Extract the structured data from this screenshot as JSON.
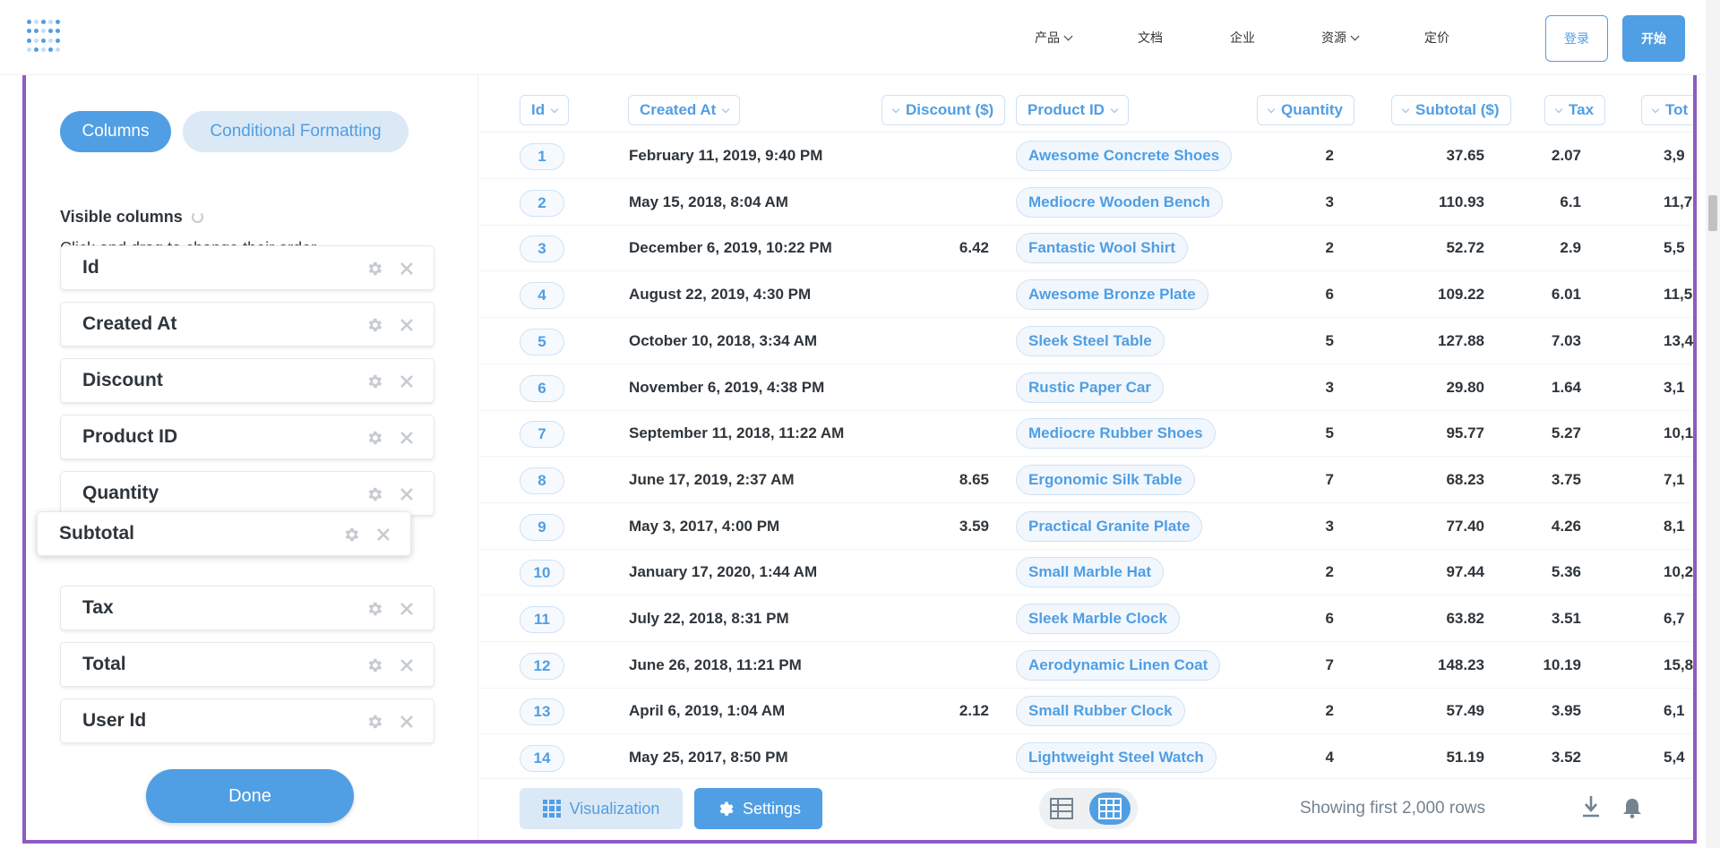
{
  "nav": {
    "links": [
      {
        "label": "产品",
        "has_caret": true
      },
      {
        "label": "文档",
        "has_caret": false
      },
      {
        "label": "企业",
        "has_caret": false
      },
      {
        "label": "资源",
        "has_caret": true
      },
      {
        "label": "定价",
        "has_caret": false
      }
    ],
    "login_label": "登录",
    "start_label": "开始"
  },
  "sidebar": {
    "tab_columns": "Columns",
    "tab_conditional": "Conditional Formatting",
    "visible_title": "Visible columns",
    "visible_subtitle": "Click and drag to change their order",
    "columns": [
      "Id",
      "Created At",
      "Discount",
      "Product ID",
      "Quantity",
      "Subtotal",
      "Tax",
      "Total",
      "User Id"
    ],
    "dragging_column": "Subtotal",
    "done_label": "Done"
  },
  "table": {
    "headers": [
      "Id",
      "Created At",
      "Discount ($)",
      "Product ID",
      "Quantity",
      "Subtotal ($)",
      "Tax",
      "Tot"
    ],
    "rows": [
      {
        "id": "1",
        "created_at": "February 11, 2019, 9:40 PM",
        "discount": "",
        "product": "Awesome Concrete Shoes",
        "quantity": "2",
        "subtotal": "37.65",
        "tax": "2.07",
        "total": "3,9"
      },
      {
        "id": "2",
        "created_at": "May 15, 2018, 8:04 AM",
        "discount": "",
        "product": "Mediocre Wooden Bench",
        "quantity": "3",
        "subtotal": "110.93",
        "tax": "6.1",
        "total": "11,7"
      },
      {
        "id": "3",
        "created_at": "December 6, 2019, 10:22 PM",
        "discount": "6.42",
        "product": "Fantastic Wool Shirt",
        "quantity": "2",
        "subtotal": "52.72",
        "tax": "2.9",
        "total": "5,5"
      },
      {
        "id": "4",
        "created_at": "August 22, 2019, 4:30 PM",
        "discount": "",
        "product": "Awesome Bronze Plate",
        "quantity": "6",
        "subtotal": "109.22",
        "tax": "6.01",
        "total": "11,5"
      },
      {
        "id": "5",
        "created_at": "October 10, 2018, 3:34 AM",
        "discount": "",
        "product": "Sleek Steel Table",
        "quantity": "5",
        "subtotal": "127.88",
        "tax": "7.03",
        "total": "13,4"
      },
      {
        "id": "6",
        "created_at": "November 6, 2019, 4:38 PM",
        "discount": "",
        "product": "Rustic Paper Car",
        "quantity": "3",
        "subtotal": "29.80",
        "tax": "1.64",
        "total": "3,1"
      },
      {
        "id": "7",
        "created_at": "September 11, 2018, 11:22 AM",
        "discount": "",
        "product": "Mediocre Rubber Shoes",
        "quantity": "5",
        "subtotal": "95.77",
        "tax": "5.27",
        "total": "10,1"
      },
      {
        "id": "8",
        "created_at": "June 17, 2019, 2:37 AM",
        "discount": "8.65",
        "product": "Ergonomic Silk Table",
        "quantity": "7",
        "subtotal": "68.23",
        "tax": "3.75",
        "total": "7,1"
      },
      {
        "id": "9",
        "created_at": "May 3, 2017, 4:00 PM",
        "discount": "3.59",
        "product": "Practical Granite Plate",
        "quantity": "3",
        "subtotal": "77.40",
        "tax": "4.26",
        "total": "8,1"
      },
      {
        "id": "10",
        "created_at": "January 17, 2020, 1:44 AM",
        "discount": "",
        "product": "Small Marble Hat",
        "quantity": "2",
        "subtotal": "97.44",
        "tax": "5.36",
        "total": "10,2"
      },
      {
        "id": "11",
        "created_at": "July 22, 2018, 8:31 PM",
        "discount": "",
        "product": "Sleek Marble Clock",
        "quantity": "6",
        "subtotal": "63.82",
        "tax": "3.51",
        "total": "6,7"
      },
      {
        "id": "12",
        "created_at": "June 26, 2018, 11:21 PM",
        "discount": "",
        "product": "Aerodynamic Linen Coat",
        "quantity": "7",
        "subtotal": "148.23",
        "tax": "10.19",
        "total": "15,8"
      },
      {
        "id": "13",
        "created_at": "April 6, 2019, 1:04 AM",
        "discount": "2.12",
        "product": "Small Rubber Clock",
        "quantity": "2",
        "subtotal": "57.49",
        "tax": "3.95",
        "total": "6,1"
      },
      {
        "id": "14",
        "created_at": "May 25, 2017, 8:50 PM",
        "discount": "",
        "product": "Lightweight Steel Watch",
        "quantity": "4",
        "subtotal": "51.19",
        "tax": "3.52",
        "total": "5,4"
      }
    ]
  },
  "footer": {
    "visualization_label": "Visualization",
    "settings_label": "Settings",
    "showing_text": "Showing first 2,000 rows"
  },
  "colors": {
    "accent": "#509ee3",
    "accent_light": "#dbe9f7",
    "frame": "#8e5bc4",
    "text": "#2e353b"
  },
  "icons": [
    "logo-icon",
    "chevron-down-icon",
    "refresh-icon",
    "gear-icon",
    "close-icon",
    "grid-icon",
    "table-icon",
    "download-icon",
    "bell-icon"
  ]
}
